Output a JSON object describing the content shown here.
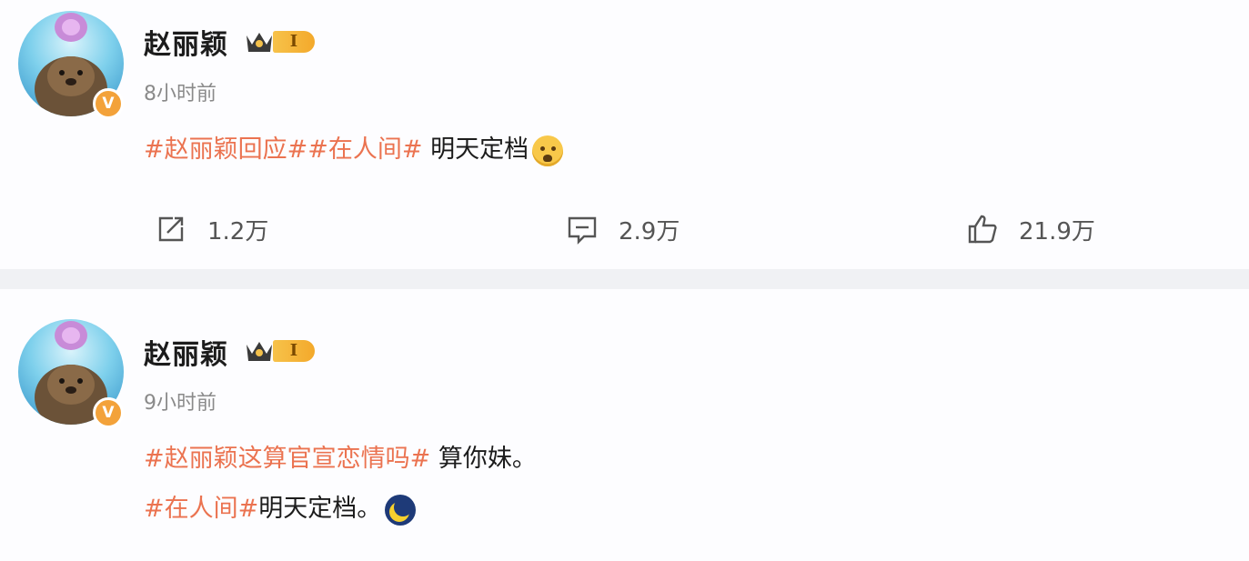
{
  "posts": [
    {
      "username": "赵丽颖",
      "level": "I",
      "time": "8小时前",
      "topic1": "#赵丽颖回应#",
      "topic2": "#在人间#",
      "text": " 明天定档",
      "emoji": "sad-emoji",
      "stats": {
        "repost": "1.2万",
        "comment": "2.9万",
        "like": "21.9万"
      }
    },
    {
      "username": "赵丽颖",
      "level": "I",
      "time": "9小时前",
      "topic1": "#赵丽颖这算官宣恋情吗#",
      "text1": " 算你妹。",
      "topic2": "#在人间#",
      "text2": "明天定档。",
      "emoji": "moon-emoji"
    }
  ],
  "colors": {
    "topic": "#eb7350",
    "badge": "#f3a23a",
    "level": "#f3a92b",
    "divider": "#f0f1f4"
  },
  "icons": [
    "repost-icon",
    "comment-icon",
    "like-icon",
    "crown-icon",
    "verified-badge-icon"
  ]
}
